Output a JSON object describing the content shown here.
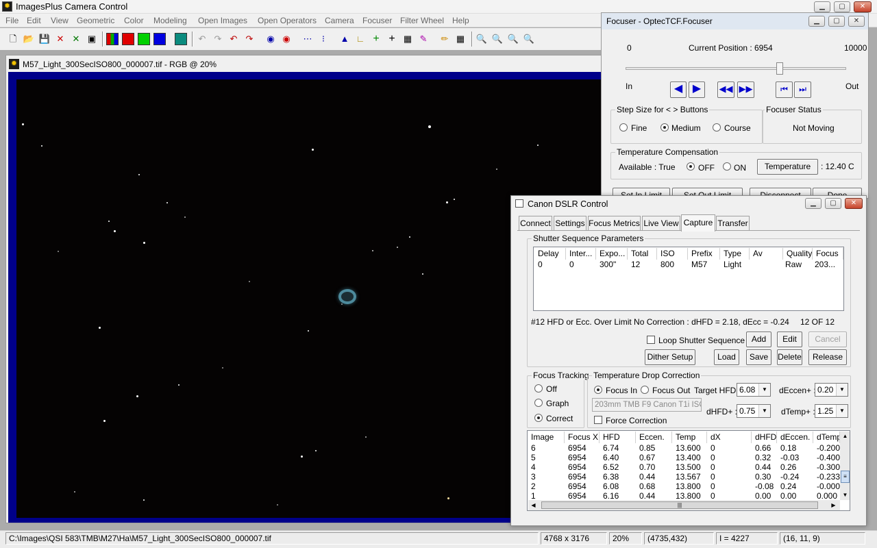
{
  "app": {
    "title": "ImagesPlus Camera Control",
    "menu": [
      "File",
      "Edit",
      "View",
      "Geometric",
      "Color",
      "Modeling",
      "Open Images",
      "Open Operators",
      "Camera",
      "Focuser",
      "Filter Wheel",
      "Help"
    ]
  },
  "image_window": {
    "title": "M57_Light_300SecISO800_000007.tif - RGB @ 20%"
  },
  "focuser": {
    "title": "Focuser - OptecTCF.Focuser",
    "min": "0",
    "max": "10000",
    "position_label": "Current Position :",
    "position_value": "6954",
    "position_fraction": 0.6954,
    "in_label": "In",
    "out_label": "Out",
    "step_group": "Step Size for < > Buttons",
    "step_options": [
      "Fine",
      "Medium",
      "Course"
    ],
    "status_group": "Focuser Status",
    "status_value": "Not Moving",
    "temp_group": "Temperature Compensation",
    "available": "Available : True",
    "off_label": "OFF",
    "on_label": "ON",
    "temp_button": "Temperature",
    "temp_value": ": 12.40 C",
    "bottom_buttons": [
      "Set In Limit",
      "Set Out Limit",
      "Disconnect",
      "Done"
    ]
  },
  "dslr": {
    "title": "Canon DSLR Control",
    "tabs": [
      "Connect",
      "Settings",
      "Focus Metrics",
      "Live View",
      "Capture",
      "Transfer"
    ],
    "active_tab": "Capture",
    "seq_group": "Shutter Sequence Parameters",
    "seq_columns": [
      "Delay",
      "Inter...",
      "Expo...",
      "Total",
      "ISO",
      "Prefix",
      "Type",
      "Av",
      "Quality",
      "Focus"
    ],
    "seq_row": [
      "0",
      "0",
      "300\"",
      "12",
      "800",
      "M57",
      "Light",
      "",
      "Raw",
      "203..."
    ],
    "status_msg": "#12 HFD or Ecc. Over Limit No Correction : dHFD = 2.18, dEcc = -0.24",
    "count_msg": "12  OF  12",
    "loop_label": "Loop Shutter Sequence",
    "buttons": {
      "add": "Add",
      "edit": "Edit",
      "cancel": "Cancel",
      "dither": "Dither Setup",
      "load": "Load",
      "save": "Save",
      "delete": "Delete",
      "release": "Release"
    },
    "tracking_group": "Focus Tracking",
    "tracking_options": [
      "Off",
      "Graph",
      "Correct"
    ],
    "tdc_group": "Temperature Drop Correction",
    "focus_in": "Focus In",
    "focus_out": "Focus Out",
    "target_hfd_label": "Target HFD:",
    "target_hfd": "6.08",
    "deccen_plus_label": "dEccen+ :",
    "deccen_plus": "0.20",
    "profile_text": "203mm TMB F9 Canon T1i ISO 4",
    "dhfd_plus_label": "dHFD+ :",
    "dhfd_plus": "0.75",
    "dtemp_plus_label": "dTemp+ :",
    "dtemp_plus": "1.25",
    "force_label": "Force Correction",
    "metrics_columns": [
      "Image",
      "Focus X",
      "HFD",
      "Eccen.",
      "Temp",
      "dX",
      "dHFD",
      "dEccen.",
      "dTemp"
    ],
    "metrics_rows": [
      [
        "6",
        "6954",
        "6.74",
        "0.85",
        "13.600",
        "0",
        "0.66",
        "0.18",
        "-0.200"
      ],
      [
        "5",
        "6954",
        "6.40",
        "0.67",
        "13.400",
        "0",
        "0.32",
        "-0.03",
        "-0.400"
      ],
      [
        "4",
        "6954",
        "6.52",
        "0.70",
        "13.500",
        "0",
        "0.44",
        "0.26",
        "-0.300"
      ],
      [
        "3",
        "6954",
        "6.38",
        "0.44",
        "13.567",
        "0",
        "0.30",
        "-0.24",
        "-0.233"
      ],
      [
        "2",
        "6954",
        "6.08",
        "0.68",
        "13.800",
        "0",
        "-0.08",
        "0.24",
        "-0.000"
      ],
      [
        "1",
        "6954",
        "6.16",
        "0.44",
        "13.800",
        "0",
        "0.00",
        "0.00",
        "0.000"
      ]
    ]
  },
  "statusbar": {
    "path": "C:\\Images\\QSI 583\\TMB\\M27\\Ha\\M57_Light_300SecISO800_000007.tif",
    "dims": "4768 x 3176",
    "zoom": "20%",
    "coords": "(4735,432)",
    "intensity": "I = 4227",
    "rgb": "(16, 11, 9)"
  },
  "colors": {
    "titlebar_active": "#0a0a0a",
    "image_border": "#00008a",
    "focuser_title_bg": "#dfe7f1",
    "dialog_bg": "#f0f0f0"
  }
}
